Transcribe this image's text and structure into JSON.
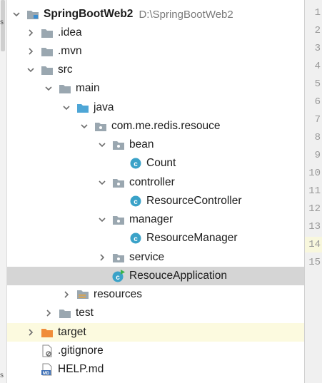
{
  "project": {
    "name": "SpringBootWeb2",
    "path": "D:\\SpringBootWeb2"
  },
  "tree": {
    "idea": ".idea",
    "mvn": ".mvn",
    "src": "src",
    "main": "main",
    "java": "java",
    "package": "com.me.redis.resouce",
    "bean": "bean",
    "count": "Count",
    "controller": "controller",
    "resource_controller": "ResourceController",
    "manager": "manager",
    "resource_manager": "ResourceManager",
    "service": "service",
    "resouce_application": "ResouceApplication",
    "resources": "resources",
    "test": "test",
    "target": "target",
    "gitignore": ".gitignore",
    "help": "HELP.md"
  },
  "line_numbers": [
    "1",
    "2",
    "3",
    "4",
    "5",
    "6",
    "7",
    "8",
    "9",
    "10",
    "11",
    "12",
    "13",
    "14",
    "15"
  ],
  "current_line": "14",
  "left_strip_glyph": "s",
  "colors": {
    "selection": "#d5d5d5",
    "excluded_bg": "#fcfadf",
    "folder": "#9aa7b0",
    "source_folder": "#4ea6d6",
    "class_icon": "#3aa2c8",
    "excluded_folder": "#f08c3a"
  }
}
